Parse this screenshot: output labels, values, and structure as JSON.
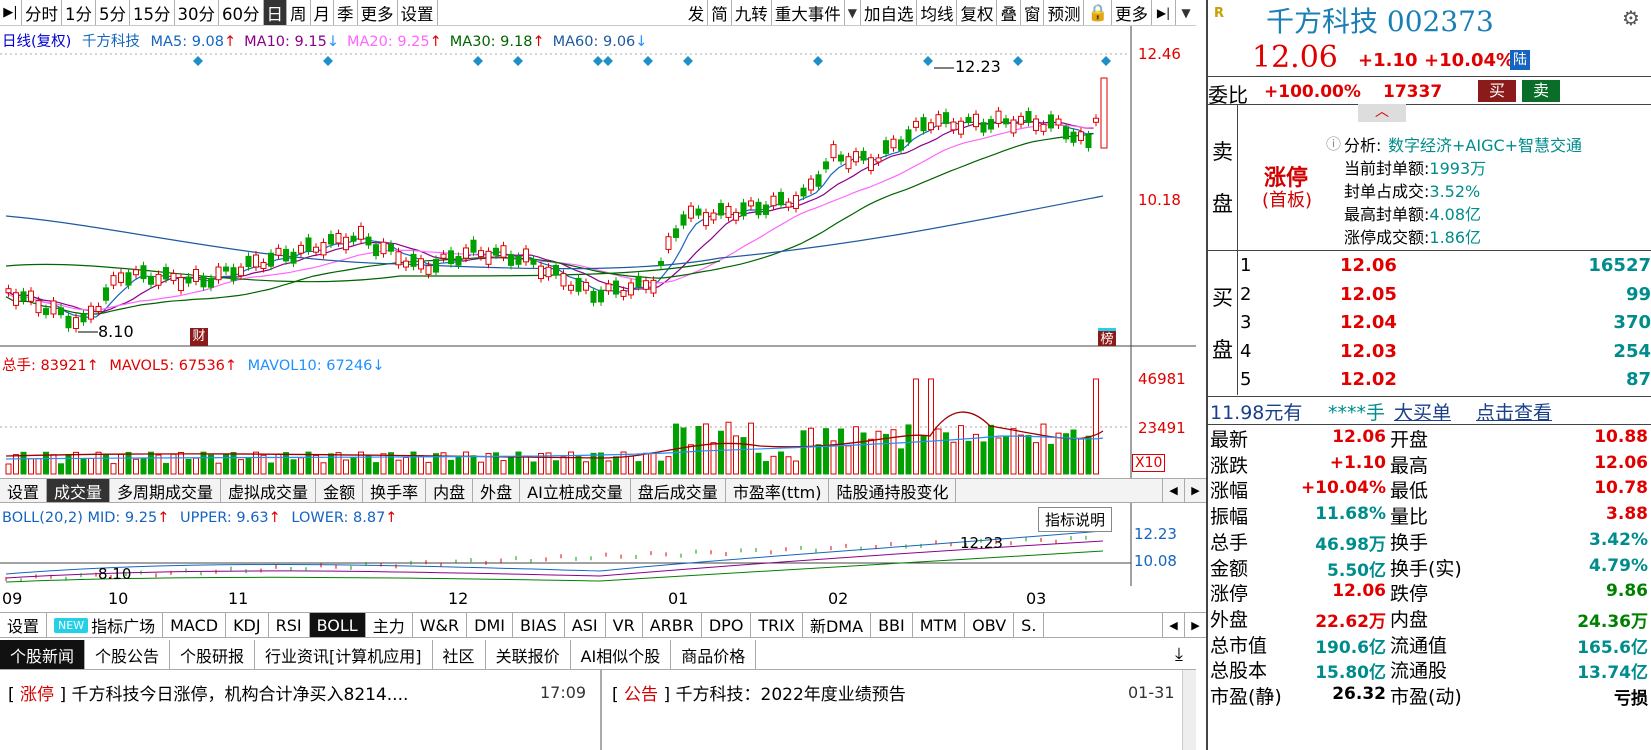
{
  "toolbar": {
    "left": [
      "分时",
      "1分",
      "5分",
      "15分",
      "30分",
      "60分",
      "日",
      "周",
      "月",
      "季",
      "更多",
      "设置"
    ],
    "right": [
      "发",
      "简",
      "九转",
      "重大事件",
      "加自选",
      "均线",
      "复权",
      "叠",
      "窗",
      "预测",
      "更多"
    ],
    "active": "日"
  },
  "main_chart": {
    "title": "日线(复权)",
    "stock_name": "千方科技",
    "ma": [
      {
        "label": "MA5: 9.08",
        "arrow": "↑",
        "color": "#1565c0"
      },
      {
        "label": "MA10: 9.15",
        "arrow": "↓",
        "color": "#8b008b"
      },
      {
        "label": "MA20: 9.25",
        "arrow": "↑",
        "color": "#ff66ff"
      },
      {
        "label": "MA30: 9.18",
        "arrow": "↑",
        "color": "#006400"
      },
      {
        "label": "MA60: 9.06",
        "arrow": "↓",
        "color": "#1e5aa0"
      }
    ],
    "price_axis": [
      "12.46",
      "10.18"
    ],
    "high_label": "12.23",
    "low_label": "8.10",
    "marker_cai": "财",
    "marker_bang": "榜"
  },
  "volume": {
    "label": "总手: 83921",
    "mavol5": "MAVOL5: 67536",
    "mavol10": "MAVOL10: 67246",
    "axis": [
      "46981",
      "23491"
    ],
    "unit": "X10"
  },
  "indicator_tabs": [
    "设置",
    "成交量",
    "多周期成交量",
    "虚拟成交量",
    "金额",
    "换手率",
    "内盘",
    "外盘",
    "AI立桩成交量",
    "盘后成交量",
    "市盈率(ttm)",
    "陆股通持股变化"
  ],
  "indicator_tabs_active": "成交量",
  "boll": {
    "label": "BOLL(20,2) MID: 9.25",
    "upper": "UPPER: 9.63",
    "lower": "LOWER: 8.87",
    "axis": [
      "12.23",
      "10.08"
    ],
    "high_label": "12.23",
    "low_label": "8.10",
    "help": "指标说明"
  },
  "date_axis": [
    "09",
    "10",
    "11",
    "12",
    "01",
    "02",
    "03"
  ],
  "bottom_tabs": [
    "设置",
    "指标广场",
    "MACD",
    "KDJ",
    "RSI",
    "BOLL",
    "主力",
    "W&R",
    "DMI",
    "BIAS",
    "ASI",
    "VR",
    "ARBR",
    "DPO",
    "TRIX",
    "新DMA",
    "BBI",
    "MTM",
    "OBV",
    "S."
  ],
  "bottom_tabs_active": "BOLL",
  "new_badge": "NEW",
  "news_tabs": [
    "个股新闻",
    "个股公告",
    "个股研报",
    "行业资讯[计算机应用]",
    "社区",
    "关联报价",
    "AI相似个股",
    "商品价格"
  ],
  "news": [
    {
      "tag": "涨停",
      "text": "千方科技今日涨停，机构合计净买入8214....",
      "time": "17:09"
    },
    {
      "tag": "公告",
      "text": "千方科技：2022年度业绩预告",
      "time": "01-31"
    }
  ],
  "quote": {
    "badge": "R",
    "name": "千方科技 002373",
    "price": "12.06",
    "change": "+1.10",
    "pct": "+10.04%",
    "lu": "陆",
    "weibi_label": "委比",
    "weibi": "+100.00%",
    "weicha": "17337",
    "buy": "买",
    "sell": "卖",
    "sell_panel": [
      "卖",
      "盘"
    ],
    "limit_label": "涨停",
    "limit_sub": "(首板)",
    "analysis_label": "分析:",
    "analysis": "数字经济+AIGC+智慧交通",
    "details": [
      {
        "k": "当前封单额:",
        "v": "1993万"
      },
      {
        "k": "封单占成交:",
        "v": "3.52%"
      },
      {
        "k": "最高封单额:",
        "v": "4.08亿"
      },
      {
        "k": "涨停成交额:",
        "v": "1.86亿"
      }
    ],
    "buy_panel": [
      "买",
      "盘"
    ],
    "bids": [
      {
        "lvl": "1",
        "price": "12.06",
        "vol": "16527"
      },
      {
        "lvl": "2",
        "price": "12.05",
        "vol": "99"
      },
      {
        "lvl": "3",
        "price": "12.04",
        "vol": "370"
      },
      {
        "lvl": "4",
        "price": "12.03",
        "vol": "254"
      },
      {
        "lvl": "5",
        "price": "12.02",
        "vol": "87"
      }
    ],
    "big_order": {
      "price": "11.98元有",
      "qty": "****手",
      "label": "大买单",
      "link": "点击查看"
    },
    "stats": [
      {
        "l": "最新",
        "lv": "12.06",
        "r": "开盘",
        "rv": "10.88"
      },
      {
        "l": "涨跌",
        "lv": "+1.10",
        "r": "最高",
        "rv": "12.06"
      },
      {
        "l": "涨幅",
        "lv": "+10.04%",
        "r": "最低",
        "rv": "10.78"
      },
      {
        "l": "振幅",
        "lv": "11.68%",
        "r": "量比",
        "rv": "3.88"
      },
      {
        "l": "总手",
        "lv": "46.98万",
        "r": "换手",
        "rv": "3.42%"
      },
      {
        "l": "金额",
        "lv": "5.50亿",
        "r": "换手(实)",
        "rv": "4.79%"
      },
      {
        "l": "涨停",
        "lv": "12.06",
        "r": "跌停",
        "rv": "9.86"
      },
      {
        "l": "外盘",
        "lv": "22.62万",
        "r": "内盘",
        "rv": "24.36万"
      },
      {
        "l": "总市值",
        "lv": "190.6亿",
        "r": "流通值",
        "rv": "165.6亿"
      },
      {
        "l": "总股本",
        "lv": "15.80亿",
        "r": "流通股",
        "rv": "13.74亿"
      },
      {
        "l": "市盈(静)",
        "lv": "26.32",
        "r": "市盈(动)",
        "rv": "亏损"
      }
    ]
  },
  "colors": {
    "up": "#e00000",
    "down": "#00a000",
    "ma5": "#1565c0",
    "ma10": "#8b008b",
    "ma20": "#ff66ff",
    "ma30": "#006400",
    "ma60": "#1e5aa0"
  }
}
